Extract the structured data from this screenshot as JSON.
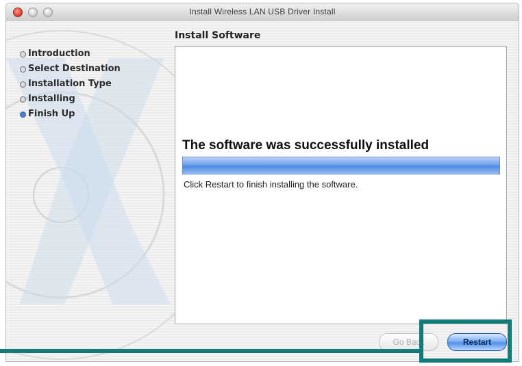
{
  "window": {
    "title": "Install Wireless LAN USB Driver Install"
  },
  "sidebar": {
    "steps": [
      {
        "label": "Introduction",
        "active": false
      },
      {
        "label": "Select Destination",
        "active": false
      },
      {
        "label": "Installation Type",
        "active": false
      },
      {
        "label": "Installing",
        "active": false
      },
      {
        "label": "Finish Up",
        "active": true
      }
    ]
  },
  "main": {
    "section_title": "Install Software",
    "success_message": "The software was successfully installed",
    "progress_fraction": 1.0,
    "instruction": "Click Restart to finish installing the software."
  },
  "buttons": {
    "go_back": "Go Back",
    "restart": "Restart"
  },
  "colors": {
    "highlight": "#127b7a",
    "progress_fill": "#5f95e4",
    "active_step_dot": "#4a7fd0"
  }
}
